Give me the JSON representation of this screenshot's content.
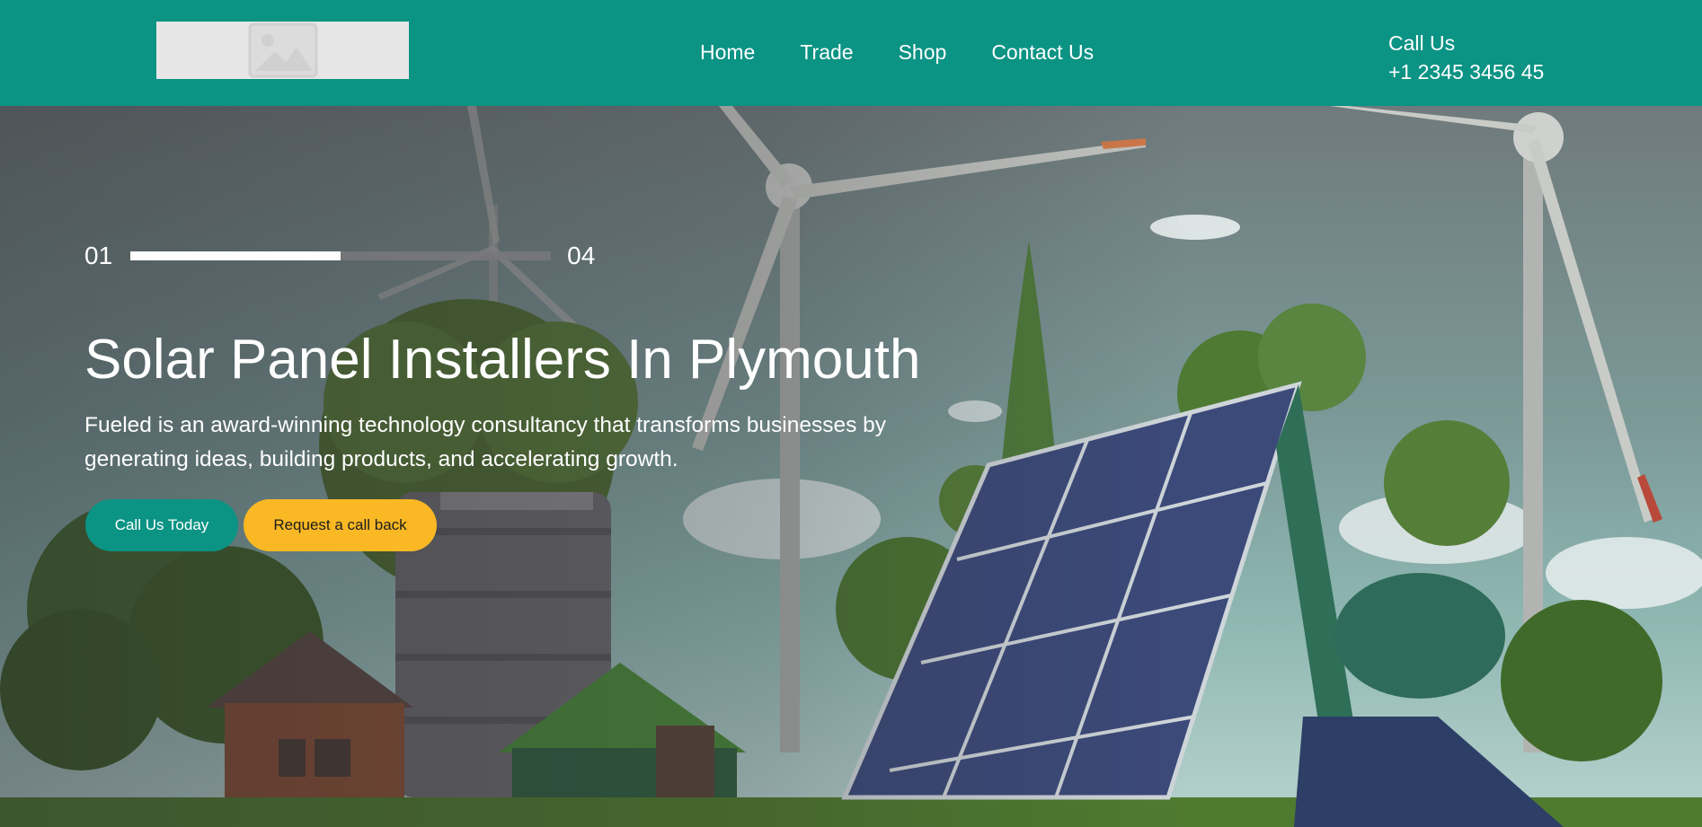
{
  "header": {
    "logo_alt": "image-placeholder-icon",
    "nav": [
      "Home",
      "Trade",
      "Shop",
      "Contact Us"
    ],
    "call_label": "Call Us",
    "phone": "+1 2345 3456 45"
  },
  "hero": {
    "slide_current": "01",
    "slide_total": "04",
    "progress": 0.5,
    "title": "Solar Panel Installers In Plymouth",
    "description": "Fueled is an award-winning technology consultancy that transforms businesses by generating ideas, building products, and accelerating growth.",
    "primary_button": "Call Us Today",
    "secondary_button": "Request a call back"
  },
  "colors": {
    "brand_teal": "#0b9384",
    "accent_yellow": "#f9b824",
    "text_light": "#ffffff"
  }
}
